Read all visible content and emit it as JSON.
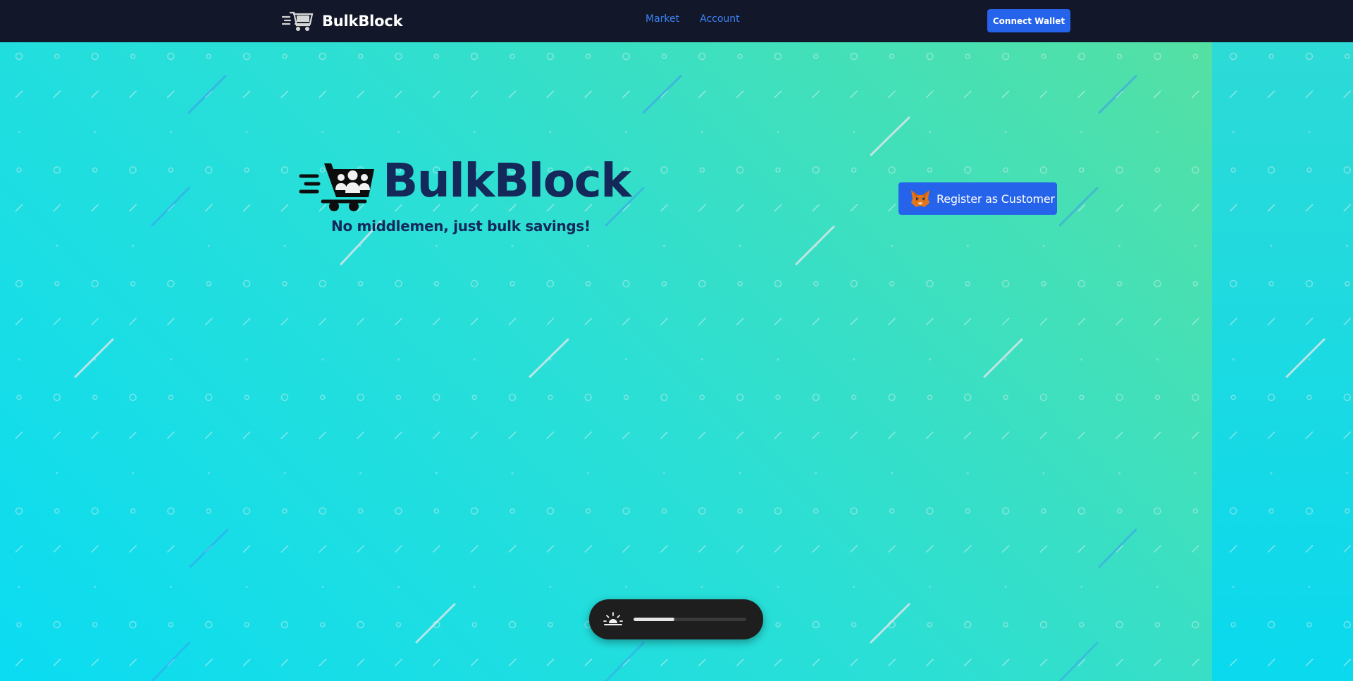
{
  "navbar": {
    "brand_name": "BulkBlock",
    "brand_icon": "cart-icon",
    "links": [
      {
        "label": "Market"
      },
      {
        "label": "Account"
      }
    ],
    "connect_button": "Connect Wallet"
  },
  "hero": {
    "logo_icon": "people-cart-icon",
    "title": "BulkBlock",
    "tagline": "No middlemen, just bulk savings!",
    "register_button": {
      "label": "Register as Customer",
      "icon": "metamask-fox-icon"
    }
  },
  "player": {
    "icon": "sunrise-icon",
    "progress": 0.36
  },
  "colors": {
    "navbar_bg": "#121829",
    "accent": "#2563eb",
    "link": "#3b82f6",
    "title": "#14285a",
    "gradient_start": "#0bdcf2",
    "gradient_end": "#5ae09c"
  }
}
